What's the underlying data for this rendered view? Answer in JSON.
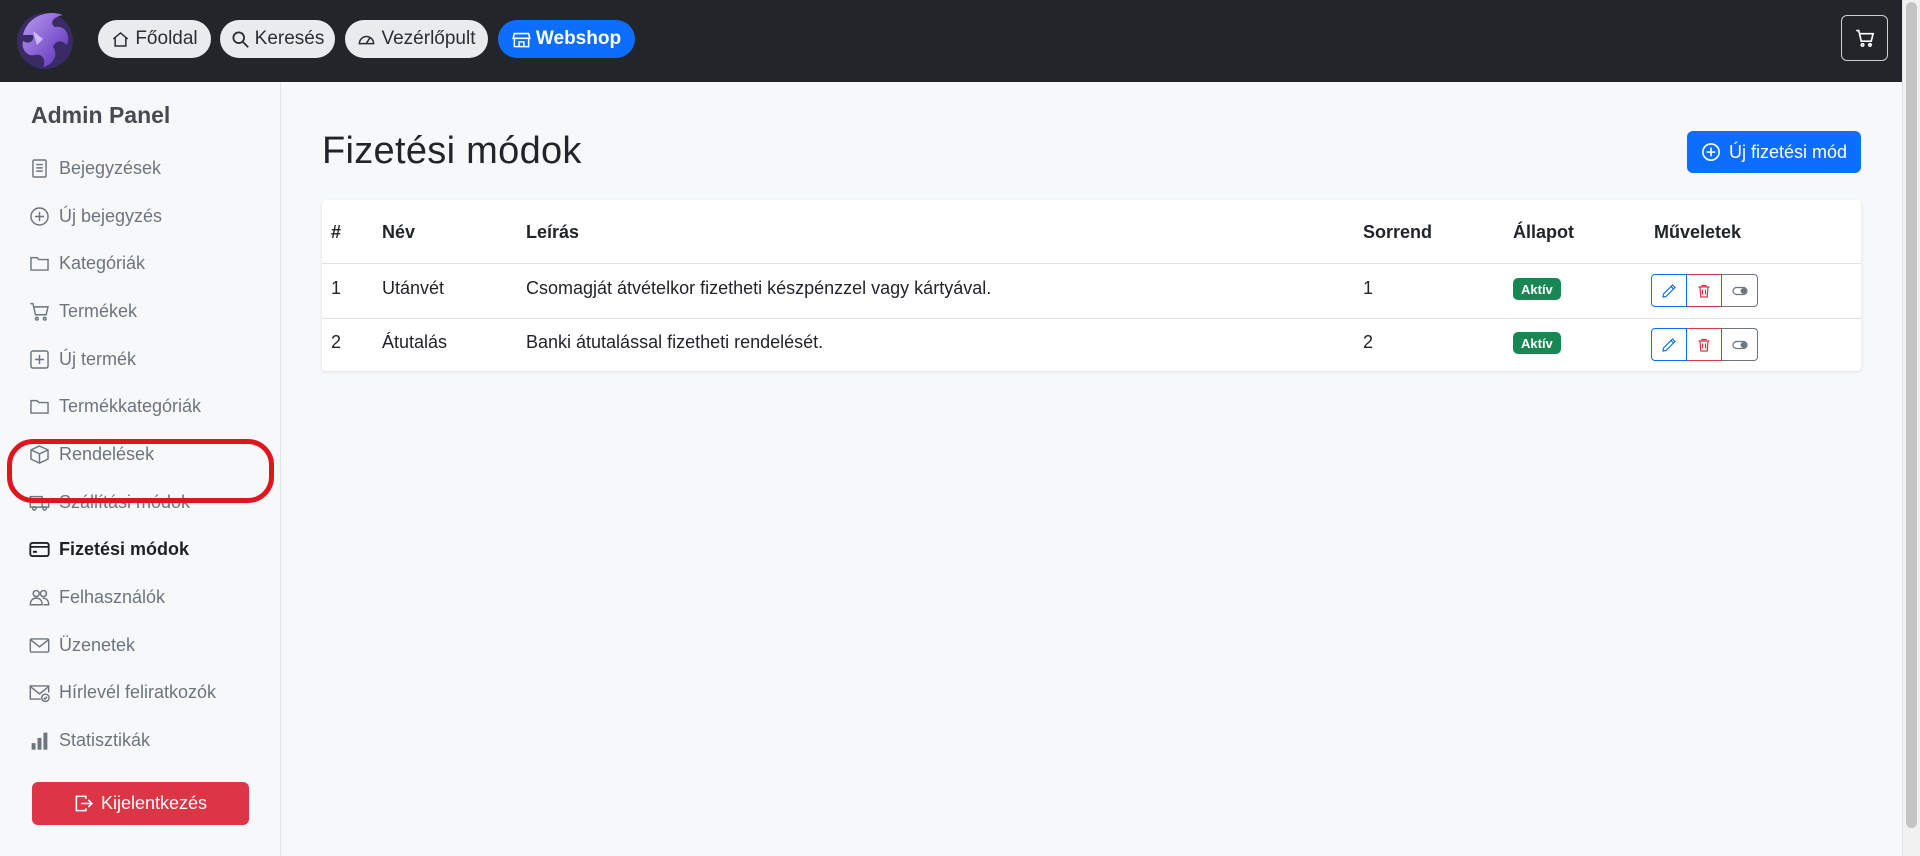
{
  "navbar": {
    "home_label": "Főoldal",
    "search_label": "Keresés",
    "dashboard_label": "Vezérlőpult",
    "webshop_label": "Webshop"
  },
  "sidebar": {
    "title": "Admin Panel",
    "items": [
      {
        "label": "Bejegyzések",
        "icon": "file-text-icon"
      },
      {
        "label": "Új bejegyzés",
        "icon": "plus-circle-icon"
      },
      {
        "label": "Kategóriák",
        "icon": "folder-icon"
      },
      {
        "label": "Termékek",
        "icon": "cart-icon"
      },
      {
        "label": "Új termék",
        "icon": "plus-square-icon"
      },
      {
        "label": "Termékkategóriák",
        "icon": "folder-icon"
      },
      {
        "label": "Rendelések",
        "icon": "box-icon"
      },
      {
        "label": "Szállítási módok",
        "icon": "truck-icon"
      },
      {
        "label": "Fizetési módok",
        "icon": "credit-card-icon",
        "active": true
      },
      {
        "label": "Felhasználók",
        "icon": "people-icon"
      },
      {
        "label": "Üzenetek",
        "icon": "envelope-icon"
      },
      {
        "label": "Hírlevél feliratkozók",
        "icon": "envelope-check-icon"
      },
      {
        "label": "Statisztikák",
        "icon": "bar-chart-icon"
      }
    ],
    "logout_label": "Kijelentkezés"
  },
  "main": {
    "title": "Fizetési módok",
    "new_button_label": "Új fizetési mód",
    "table": {
      "headers": [
        "#",
        "Név",
        "Leírás",
        "Sorrend",
        "Állapot",
        "Műveletek"
      ],
      "rows": [
        {
          "id": "1",
          "name": "Utánvét",
          "description": "Csomagját átvételkor fizetheti készpénzzel vagy kártyával.",
          "order": "1",
          "status": "Aktív"
        },
        {
          "id": "2",
          "name": "Átutalás",
          "description": "Banki átutalással fizetheti rendelését.",
          "order": "2",
          "status": "Aktív"
        }
      ]
    }
  },
  "colors": {
    "navbar_bg": "#22252a",
    "primary": "#0d6efd",
    "danger": "#dc3545",
    "success": "#198754",
    "highlight": "#e0161e"
  }
}
